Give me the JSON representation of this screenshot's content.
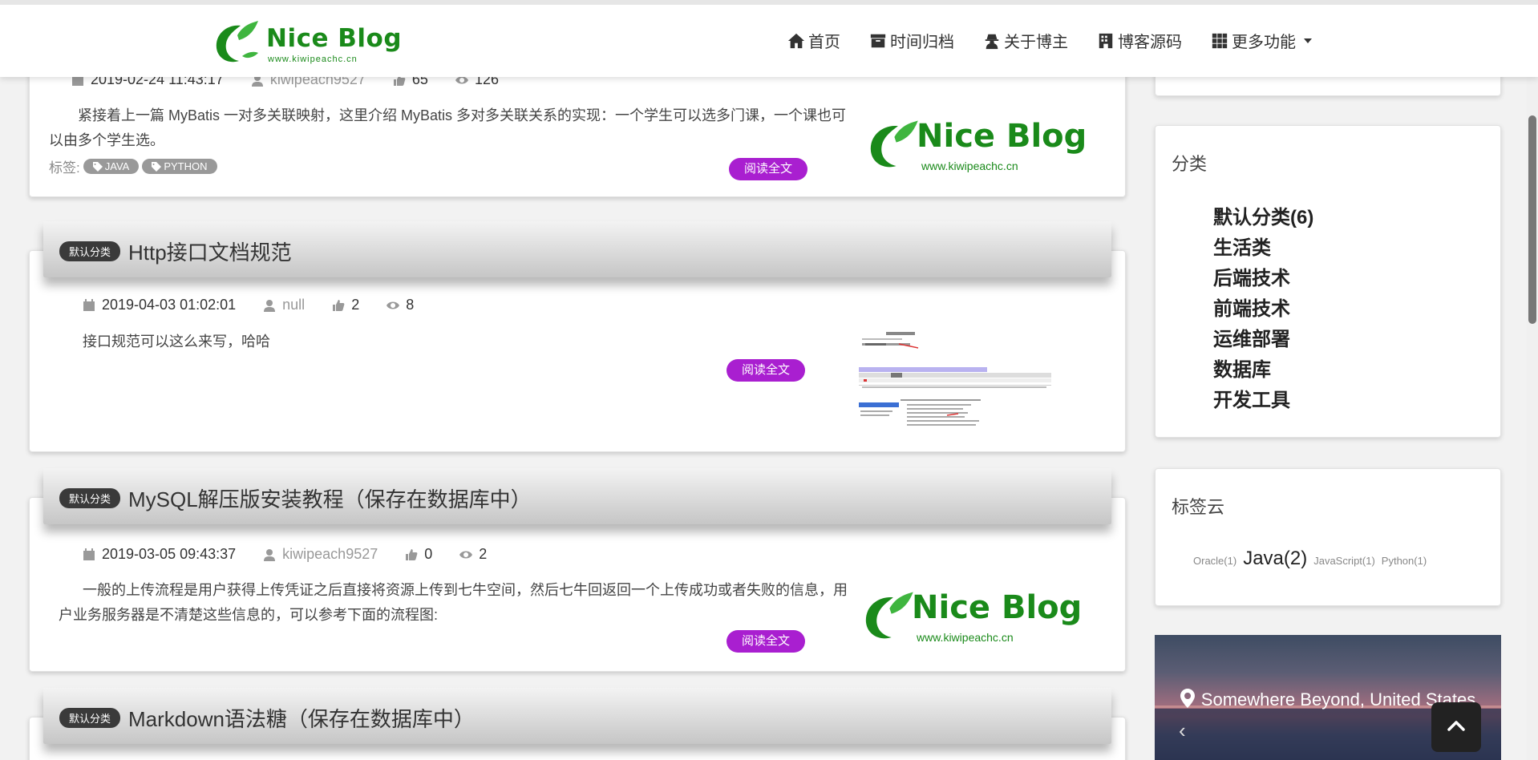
{
  "brand": {
    "title": "Nice Blog",
    "subtitle": "www.kiwipeachc.cn"
  },
  "nav": [
    {
      "label": "首页",
      "icon": "home-icon"
    },
    {
      "label": "时间归档",
      "icon": "archive-icon"
    },
    {
      "label": "关于博主",
      "icon": "user-secret-icon"
    },
    {
      "label": "博客源码",
      "icon": "building-icon"
    },
    {
      "label": "更多功能",
      "icon": "grid-icon"
    }
  ],
  "posts": [
    {
      "date": "2019-02-24 11:43:17",
      "author": "kiwipeach9527",
      "likes": "65",
      "views": "126",
      "excerpt": "紧接着上一篇 MyBatis 一对多关联映射，这里介绍 MyBatis 多对多关联关系的实现：一个学生可以选多门课，一个课也可以由多个学生选。",
      "tags_label": "标签:",
      "tags": [
        "JAVA",
        "PYTHON"
      ],
      "read_more": "阅读全文"
    },
    {
      "category": "默认分类",
      "title": "Http接口文档规范",
      "date": "2019-04-03 01:02:01",
      "author": "null",
      "likes": "2",
      "views": "8",
      "excerpt": "接口规范可以这么来写，哈哈",
      "read_more": "阅读全文"
    },
    {
      "category": "默认分类",
      "title": "MySQL解压版安装教程（保存在数据库中）",
      "date": "2019-03-05 09:43:37",
      "author": "kiwipeach9527",
      "likes": "0",
      "views": "2",
      "excerpt": "一般的上传流程是用户获得上传凭证之后直接将资源上传到七牛空间，然后七牛回返回一个上传成功或者失败的信息，用户业务服务器是不清楚这些信息的，可以参考下面的流程图:",
      "read_more": "阅读全文"
    },
    {
      "category": "默认分类",
      "title": "Markdown语法糖（保存在数据库中）"
    }
  ],
  "sidebar": {
    "categories_title": "分类",
    "categories": [
      "默认分类(6)",
      "生活类",
      "后端技术",
      "前端技术",
      "运维部署",
      "数据库",
      "开发工具"
    ],
    "tagcloud_title": "标签云",
    "tagcloud": [
      "Oracle(1)",
      "Java(2)",
      "JavaScript(1)",
      "Python(1)"
    ],
    "banner_text": "Somewhere Beyond, United States"
  },
  "colors": {
    "brand_green": "#1a8a1a",
    "read_button": "#a91fd0",
    "badge": "#3a3a3a"
  }
}
